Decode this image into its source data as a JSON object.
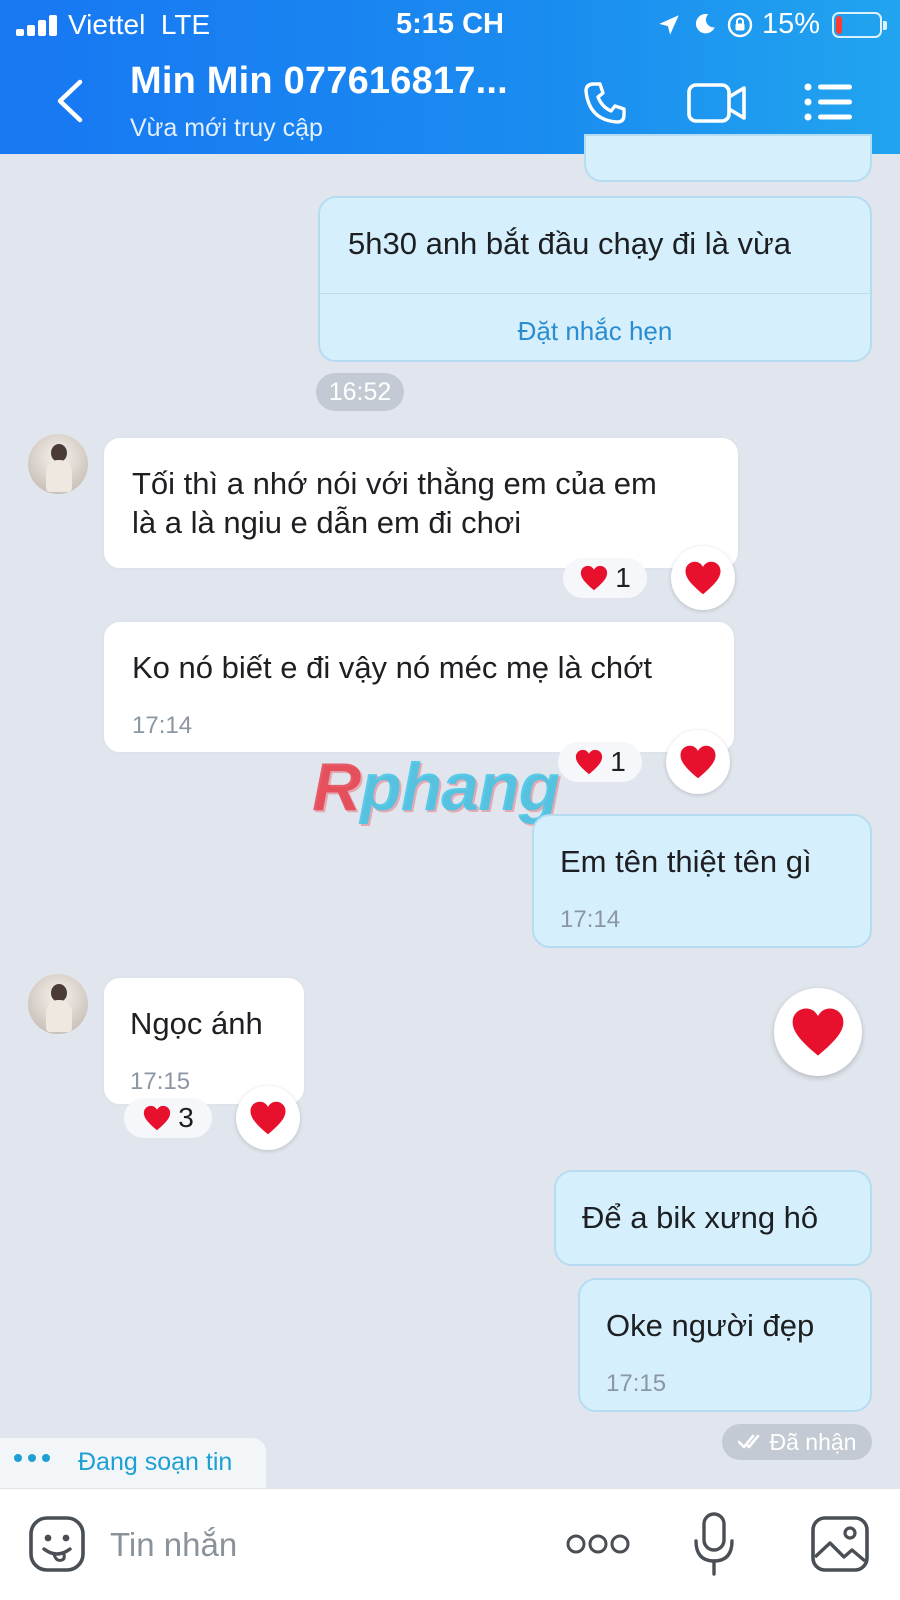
{
  "status_bar": {
    "carrier": "Viettel",
    "network": "LTE",
    "time": "5:15 CH",
    "battery_percent": "15%",
    "battery_level": 0.15,
    "battery_color": "#ff3b30"
  },
  "header": {
    "contact_name": "Min Min 077616817...",
    "contact_status": "Vừa mới truy cập",
    "icons": [
      "back-arrow-icon",
      "phone-icon",
      "video-camera-icon",
      "list-menu-icon"
    ]
  },
  "messages": [
    {
      "side": "sent",
      "text": "5h30 anh bắt đầu chạy đi là vừa",
      "action": "Đặt nhắc hẹn"
    },
    {
      "type": "time_separator",
      "text": "16:52"
    },
    {
      "side": "received",
      "lines": [
        "Tối thì a nhớ nói với thằng em của em",
        "là a là ngiu e dẫn em đi chơi"
      ],
      "reaction_count": "1"
    },
    {
      "side": "received",
      "text": "Ko nó biết e đi vậy nó méc mẹ là chớt",
      "time": "17:14",
      "reaction_count": "1"
    },
    {
      "side": "sent",
      "text": "Em tên thiệt tên gì",
      "time": "17:14"
    },
    {
      "side": "received",
      "text": "Ngọc ánh",
      "time": "17:15",
      "reaction_count": "3"
    },
    {
      "side": "sent",
      "text": "Để a bik xưng hô"
    },
    {
      "side": "sent",
      "text": "Oke người đẹp",
      "time": "17:15"
    }
  ],
  "watermark": {
    "first": "R",
    "rest": "phang"
  },
  "seen_status": "Đã nhận",
  "typing_indicator": "Đang soạn tin",
  "input": {
    "placeholder": "Tin nhắn"
  },
  "colors": {
    "header_gradient_start": "#1877f2",
    "header_gradient_end": "#21a4ef",
    "sent_bubble": "#d5effc",
    "received_bubble": "#ffffff",
    "chat_background": "#e1e6ee",
    "heart": "#e8112d",
    "link_blue": "#2b8ccf"
  }
}
